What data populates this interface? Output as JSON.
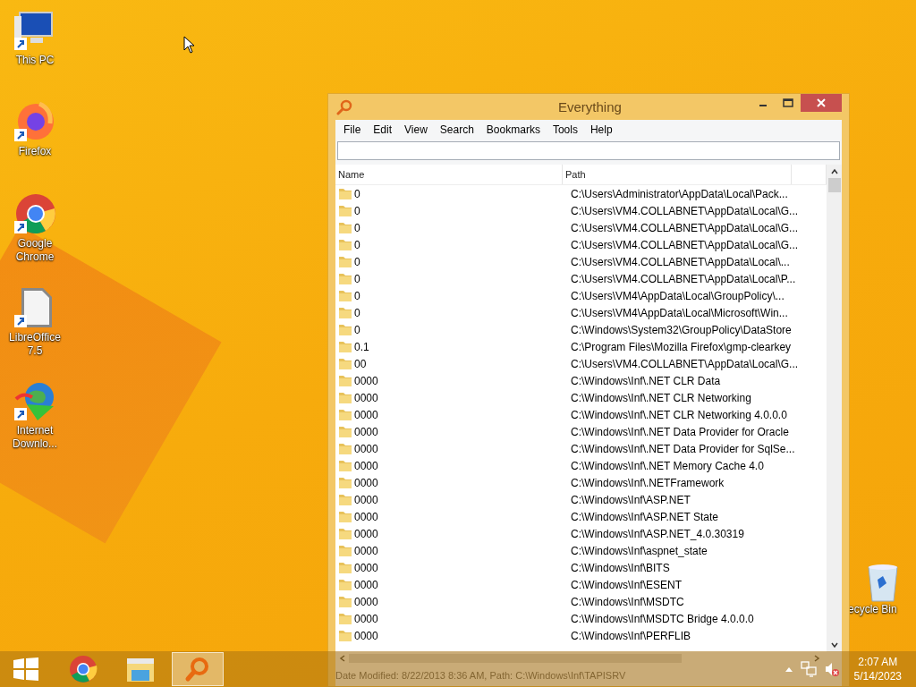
{
  "desktop_icons": [
    {
      "kind": "pc",
      "label": "This PC"
    },
    {
      "kind": "firefox",
      "label": "Firefox"
    },
    {
      "kind": "chrome",
      "label": "Google Chrome"
    },
    {
      "kind": "libreoffice",
      "label": "LibreOffice 7.5"
    },
    {
      "kind": "idm",
      "label": "Internet Downlo..."
    }
  ],
  "recycle_bin": {
    "label": "ecycle Bin"
  },
  "window": {
    "title": "Everything",
    "menu": [
      "File",
      "Edit",
      "View",
      "Search",
      "Bookmarks",
      "Tools",
      "Help"
    ],
    "table": {
      "columns": [
        "Name",
        "Path"
      ],
      "rows": [
        {
          "name": "0",
          "path": "C:\\Users\\Administrator\\AppData\\Local\\Pack..."
        },
        {
          "name": "0",
          "path": "C:\\Users\\VM4.COLLABNET\\AppData\\Local\\G..."
        },
        {
          "name": "0",
          "path": "C:\\Users\\VM4.COLLABNET\\AppData\\Local\\G..."
        },
        {
          "name": "0",
          "path": "C:\\Users\\VM4.COLLABNET\\AppData\\Local\\G..."
        },
        {
          "name": "0",
          "path": "C:\\Users\\VM4.COLLABNET\\AppData\\Local\\..."
        },
        {
          "name": "0",
          "path": "C:\\Users\\VM4.COLLABNET\\AppData\\Local\\P..."
        },
        {
          "name": "0",
          "path": "C:\\Users\\VM4\\AppData\\Local\\GroupPolicy\\..."
        },
        {
          "name": "0",
          "path": "C:\\Users\\VM4\\AppData\\Local\\Microsoft\\Win..."
        },
        {
          "name": "0",
          "path": "C:\\Windows\\System32\\GroupPolicy\\DataStore"
        },
        {
          "name": "0.1",
          "path": "C:\\Program Files\\Mozilla Firefox\\gmp-clearkey"
        },
        {
          "name": "00",
          "path": "C:\\Users\\VM4.COLLABNET\\AppData\\Local\\G..."
        },
        {
          "name": "0000",
          "path": "C:\\Windows\\Inf\\.NET CLR Data"
        },
        {
          "name": "0000",
          "path": "C:\\Windows\\Inf\\.NET CLR Networking"
        },
        {
          "name": "0000",
          "path": "C:\\Windows\\Inf\\.NET CLR Networking 4.0.0.0"
        },
        {
          "name": "0000",
          "path": "C:\\Windows\\Inf\\.NET Data Provider for Oracle"
        },
        {
          "name": "0000",
          "path": "C:\\Windows\\Inf\\.NET Data Provider for SqlSe..."
        },
        {
          "name": "0000",
          "path": "C:\\Windows\\Inf\\.NET Memory Cache 4.0"
        },
        {
          "name": "0000",
          "path": "C:\\Windows\\Inf\\.NETFramework"
        },
        {
          "name": "0000",
          "path": "C:\\Windows\\Inf\\ASP.NET"
        },
        {
          "name": "0000",
          "path": "C:\\Windows\\Inf\\ASP.NET State"
        },
        {
          "name": "0000",
          "path": "C:\\Windows\\Inf\\ASP.NET_4.0.30319"
        },
        {
          "name": "0000",
          "path": "C:\\Windows\\Inf\\aspnet_state"
        },
        {
          "name": "0000",
          "path": "C:\\Windows\\Inf\\BITS"
        },
        {
          "name": "0000",
          "path": "C:\\Windows\\Inf\\ESENT"
        },
        {
          "name": "0000",
          "path": "C:\\Windows\\Inf\\MSDTC"
        },
        {
          "name": "0000",
          "path": "C:\\Windows\\Inf\\MSDTC Bridge 4.0.0.0"
        },
        {
          "name": "0000",
          "path": "C:\\Windows\\Inf\\PERFLIB"
        }
      ]
    },
    "status_bar": "Date Modified: 8/22/2013 8:36 AM, Path: C:\\Windows\\Inf\\TAPISRV"
  },
  "taskbar": {
    "apps": [
      {
        "kind": "start",
        "selected": false
      },
      {
        "kind": "chrome",
        "selected": false
      },
      {
        "kind": "explorer",
        "selected": false
      },
      {
        "kind": "everything",
        "selected": true
      }
    ],
    "clock": {
      "time": "2:07 AM",
      "date": "5/14/2023"
    }
  }
}
